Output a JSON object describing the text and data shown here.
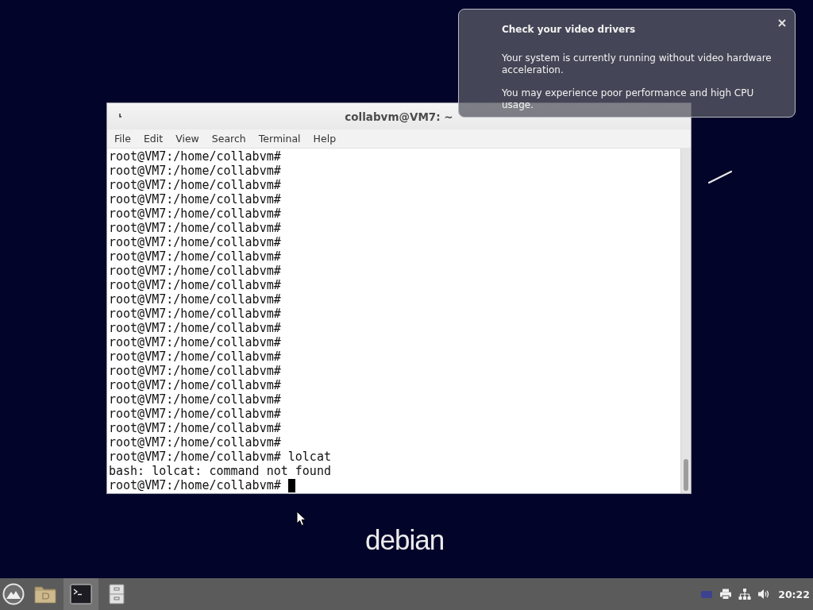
{
  "notification": {
    "title": "Check your video drivers",
    "paragraphs": [
      "Your system is currently running without video hardware acceleration.",
      "You may experience poor performance and high CPU usage."
    ]
  },
  "terminal_window": {
    "title": "collabvm@VM7: ~",
    "menu": [
      "File",
      "Edit",
      "View",
      "Search",
      "Terminal",
      "Help"
    ],
    "lines": [
      "root@VM7:/home/collabvm#",
      "root@VM7:/home/collabvm#",
      "root@VM7:/home/collabvm#",
      "root@VM7:/home/collabvm#",
      "root@VM7:/home/collabvm#",
      "root@VM7:/home/collabvm#",
      "root@VM7:/home/collabvm#",
      "root@VM7:/home/collabvm#",
      "root@VM7:/home/collabvm#",
      "root@VM7:/home/collabvm#",
      "root@VM7:/home/collabvm#",
      "root@VM7:/home/collabvm#",
      "root@VM7:/home/collabvm#",
      "root@VM7:/home/collabvm#",
      "root@VM7:/home/collabvm#",
      "root@VM7:/home/collabvm#",
      "root@VM7:/home/collabvm#",
      "root@VM7:/home/collabvm#",
      "root@VM7:/home/collabvm#",
      "root@VM7:/home/collabvm#",
      "root@VM7:/home/collabvm#",
      "root@VM7:/home/collabvm# lolcat",
      "bash: lolcat: command not found",
      "root@VM7:/home/collabvm#"
    ],
    "cursor_visible": true
  },
  "desktop": {
    "logo": "debian"
  },
  "taskbar": {
    "launchers": [
      {
        "kind": "start",
        "selected": false
      },
      {
        "kind": "folder",
        "selected": false
      },
      {
        "kind": "terminal",
        "selected": true
      },
      {
        "kind": "cabinet",
        "selected": false
      }
    ],
    "tray": [
      {
        "kind": "keyboard"
      },
      {
        "kind": "printer"
      },
      {
        "kind": "network"
      },
      {
        "kind": "volume"
      }
    ],
    "clock": "20:22"
  }
}
